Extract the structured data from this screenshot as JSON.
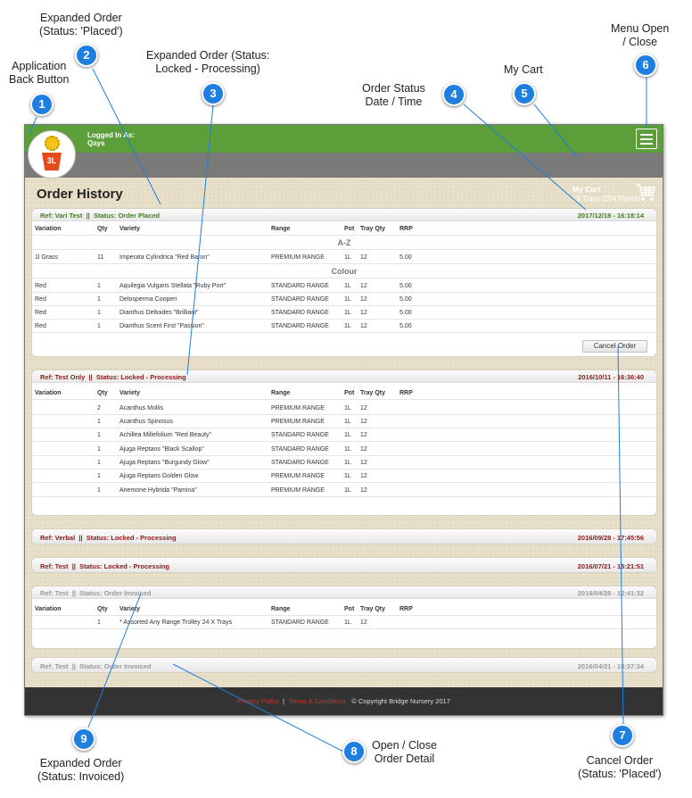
{
  "annotations": [
    {
      "num": "1",
      "label": "Application\nBack Button"
    },
    {
      "num": "2",
      "label": "Expanded Order\n(Status: 'Placed')"
    },
    {
      "num": "3",
      "label": "Expanded Order (Status:\nLocked - Processing)"
    },
    {
      "num": "4",
      "label": "Order Status\nDate / Time"
    },
    {
      "num": "5",
      "label": "My Cart"
    },
    {
      "num": "6",
      "label": "Menu Open\n/ Close"
    },
    {
      "num": "7",
      "label": "Cancel Order\n(Status: 'Placed')"
    },
    {
      "num": "8",
      "label": "Open / Close\nOrder Detail"
    },
    {
      "num": "9",
      "label": "Expanded Order\n(Status: Invoiced)"
    }
  ],
  "header": {
    "logo_text": "3L",
    "logged_in_label": "Logged In As:",
    "logged_in_user": "Qays"
  },
  "cart": {
    "title": "My Cart",
    "summary": "19 Trays (204 Plants)"
  },
  "page_title": "Order History",
  "columns": {
    "variation": "Variation",
    "qty": "Qty",
    "variety": "Variety",
    "range": "Range",
    "pot": "Pot",
    "tray_qty": "Tray Qty",
    "rrp": "RRP"
  },
  "orders": [
    {
      "ref": "Ref: Vari Test",
      "sep": "||",
      "status": "Status: Order Placed",
      "datetime": "2017/12/18 - 16:18:14",
      "groups": [
        {
          "name": "A-Z",
          "rows": [
            {
              "variation": "1l Grass",
              "qty": "11",
              "variety": "Imperata Cylindrica \"Red Baron\"",
              "range": "PREMIUM RANGE",
              "pot": "1L",
              "tray_qty": "12",
              "rrp": "5.00"
            }
          ]
        },
        {
          "name": "Colour",
          "rows": [
            {
              "variation": "Red",
              "qty": "1",
              "variety": "Aquilegia Vulgaris Stellata \"Ruby Port\"",
              "range": "STANDARD RANGE",
              "pot": "1L",
              "tray_qty": "12",
              "rrp": "5.00"
            },
            {
              "variation": "Red",
              "qty": "1",
              "variety": "Delosperma Cooperi",
              "range": "STANDARD RANGE",
              "pot": "1L",
              "tray_qty": "12",
              "rrp": "5.00"
            },
            {
              "variation": "Red",
              "qty": "1",
              "variety": "Dianthus Deltoides \"Brilliant\"",
              "range": "STANDARD RANGE",
              "pot": "1L",
              "tray_qty": "12",
              "rrp": "5.00"
            },
            {
              "variation": "Red",
              "qty": "1",
              "variety": "Dianthus Scent First \"Passion\"",
              "range": "STANDARD RANGE",
              "pot": "1L",
              "tray_qty": "12",
              "rrp": "5.00"
            }
          ]
        }
      ],
      "cancel_label": "Cancel Order"
    },
    {
      "ref": "Ref: Test Only",
      "sep": "||",
      "status": "Status: Locked - Processing",
      "datetime": "2016/10/11 - 16:36:40",
      "rows": [
        {
          "variation": "",
          "qty": "2",
          "variety": "Acanthus Mollis",
          "range": "PREMIUM RANGE",
          "pot": "1L",
          "tray_qty": "12",
          "rrp": ""
        },
        {
          "variation": "",
          "qty": "1",
          "variety": "Acanthus Spinosus",
          "range": "PREMIUM RANGE",
          "pot": "1L",
          "tray_qty": "12",
          "rrp": ""
        },
        {
          "variation": "",
          "qty": "1",
          "variety": "Achillea Millefolium \"Red Beauty\"",
          "range": "STANDARD RANGE",
          "pot": "1L",
          "tray_qty": "12",
          "rrp": ""
        },
        {
          "variation": "",
          "qty": "1",
          "variety": "Ajuga Reptans \"Black Scallop\"",
          "range": "STANDARD RANGE",
          "pot": "1L",
          "tray_qty": "12",
          "rrp": ""
        },
        {
          "variation": "",
          "qty": "1",
          "variety": "Ajuga Reptans \"Burgundy Glow\"",
          "range": "STANDARD RANGE",
          "pot": "1L",
          "tray_qty": "12",
          "rrp": ""
        },
        {
          "variation": "",
          "qty": "1",
          "variety": "Ajuga Reptans Golden Glow",
          "range": "PREMIUM RANGE",
          "pot": "1L",
          "tray_qty": "12",
          "rrp": ""
        },
        {
          "variation": "",
          "qty": "1",
          "variety": "Anemone Hybrida \"Pamina\"",
          "range": "PREMIUM RANGE",
          "pot": "1L",
          "tray_qty": "12",
          "rrp": ""
        }
      ]
    },
    {
      "ref": "Ref: Verbal",
      "sep": "||",
      "status": "Status: Locked - Processing",
      "datetime": "2016/09/28 - 17:45:56"
    },
    {
      "ref": "Ref: Test",
      "sep": "||",
      "status": "Status: Locked - Processing",
      "datetime": "2016/07/21 - 15:21:51"
    },
    {
      "ref": "Ref: Test",
      "sep": "||",
      "status": "Status: Order Invoiced",
      "datetime": "2016/04/28 - 12:41:32",
      "rows": [
        {
          "variation": "",
          "qty": "1",
          "variety": "* Assorted Any Range Trolley 24 X Trays",
          "range": "STANDARD RANGE",
          "pot": "1L",
          "tray_qty": "12",
          "rrp": ""
        }
      ]
    },
    {
      "ref": "Ref: Test",
      "sep": "||",
      "status": "Status: Order Invoiced",
      "datetime": "2016/04/21 - 15:37:34"
    }
  ],
  "footer": {
    "privacy": "Privacy Policy",
    "sep": "|",
    "terms": "Terms & Conditions",
    "copyright": "© Copyright Bridge Nursery 2017"
  },
  "colors": {
    "badge": "#1e7fe0",
    "header_green": "#5b9e3a",
    "status_placed": "#3e7d1e",
    "status_locked": "#8b1a1a",
    "status_invoiced": "#9a9a9a"
  },
  "icons": [
    "menu-icon",
    "cart-icon",
    "flower-pot-logo"
  ]
}
